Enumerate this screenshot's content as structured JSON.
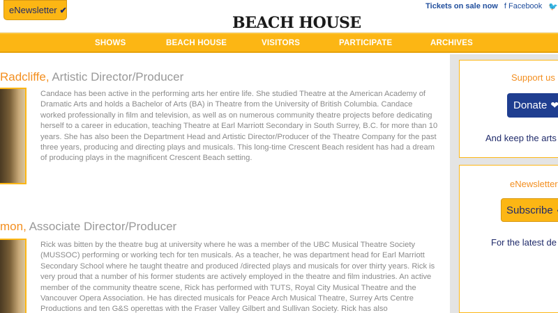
{
  "topbar": {
    "enewsletter_label": "eNewsletter",
    "enewsletter_check": "✔",
    "tickets_label": "Tickets on sale now",
    "facebook_label": "f Facebook",
    "twitter_label": "🐦"
  },
  "logo": {
    "text": "BEACH HOUSE"
  },
  "nav": {
    "items": [
      {
        "label": "SHOWS"
      },
      {
        "label": "BEACH HOUSE"
      },
      {
        "label": "VISITORS"
      },
      {
        "label": "PARTICIPATE"
      },
      {
        "label": "ARCHIVES"
      }
    ]
  },
  "people": [
    {
      "name_highlight": "Radcliffe,",
      "role": " Artistic Director/Producer",
      "bio": "Candace has been active in the performing arts her entire life. She studied Theatre at the American Academy of Dramatic Arts and holds a Bachelor of Arts (BA) in Theatre from the University of British Columbia. Candace worked professionally in film and television, as well as on numerous community theatre projects before dedicating herself to a career in education, teaching Theatre at Earl Marriott Secondary in South Surrey, B.C. for more than 10 years. She has also been the Department Head and Artistic Director/Producer of the Theatre Company for the past three years, producing and directing plays and musicals. This long-time Crescent Beach resident has had a dream of producing plays in the magnificent Crescent Beach setting."
    },
    {
      "name_highlight": "mon,",
      "role": " Associate Director/Producer",
      "bio": "Rick was bitten by the theatre bug at university where he was a member of the UBC Musical Theatre Society (MUSSOC) performing or working tech for ten musicals. As a teacher, he was department head for Earl Marriott Secondary School where he taught theatre and produced /directed plays and musicals for over thirty years. Rick is very proud that a number of his former students are actively employed in the theatre and film industries. An active member of the community theatre scene, Rick has performed with TUTS, Royal City Musical Theatre and the Vancouver Opera Association. He has directed musicals for Peace Arch Musical Theatre, Surrey Arts Centre Productions and ten G&S operettas with the Fraser Valley Gilbert and Sullivan Society. Rick has also"
    }
  ],
  "sidebar": {
    "support_title": "Support us",
    "donate_label": "Donate",
    "donate_icon": "❤",
    "support_text": "And keep the arts",
    "enews_title": "eNewsletter",
    "subscribe_label": "Subscribe",
    "subscribe_icon": "✔",
    "enews_text": "For the latest de"
  }
}
